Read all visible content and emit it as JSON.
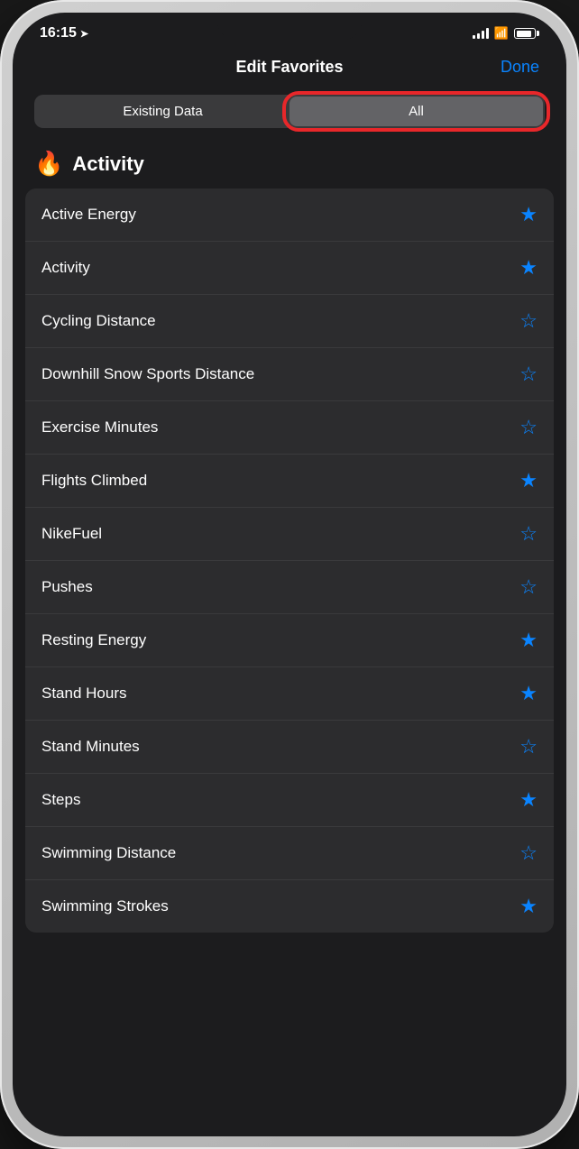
{
  "statusBar": {
    "time": "16:15",
    "locationArrow": "➤"
  },
  "navigation": {
    "title": "Edit Favorites",
    "doneLabel": "Done"
  },
  "segmentControl": {
    "options": [
      "Existing Data",
      "All"
    ],
    "activeIndex": 1
  },
  "activitySection": {
    "title": "Activity",
    "flameEmoji": "🔥"
  },
  "listItems": [
    {
      "label": "Active Energy",
      "favorited": true
    },
    {
      "label": "Activity",
      "favorited": true
    },
    {
      "label": "Cycling Distance",
      "favorited": false
    },
    {
      "label": "Downhill Snow Sports Distance",
      "favorited": false
    },
    {
      "label": "Exercise Minutes",
      "favorited": false
    },
    {
      "label": "Flights Climbed",
      "favorited": true
    },
    {
      "label": "NikeFuel",
      "favorited": false
    },
    {
      "label": "Pushes",
      "favorited": false
    },
    {
      "label": "Resting Energy",
      "favorited": true
    },
    {
      "label": "Stand Hours",
      "favorited": true
    },
    {
      "label": "Stand Minutes",
      "favorited": false
    },
    {
      "label": "Steps",
      "favorited": true
    },
    {
      "label": "Swimming Distance",
      "favorited": false
    },
    {
      "label": "Swimming Strokes",
      "favorited": true
    }
  ]
}
